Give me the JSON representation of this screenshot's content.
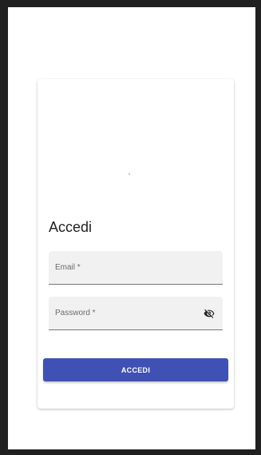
{
  "login": {
    "title": "Accedi",
    "email_label": "Email *",
    "password_label": "Password *",
    "submit_label": "ACCEDI"
  },
  "icons": {
    "password_toggle": "eye-off-icon"
  },
  "colors": {
    "primary": "#3f51b5",
    "field_bg": "#f1f1f1",
    "frame": "#202020"
  }
}
